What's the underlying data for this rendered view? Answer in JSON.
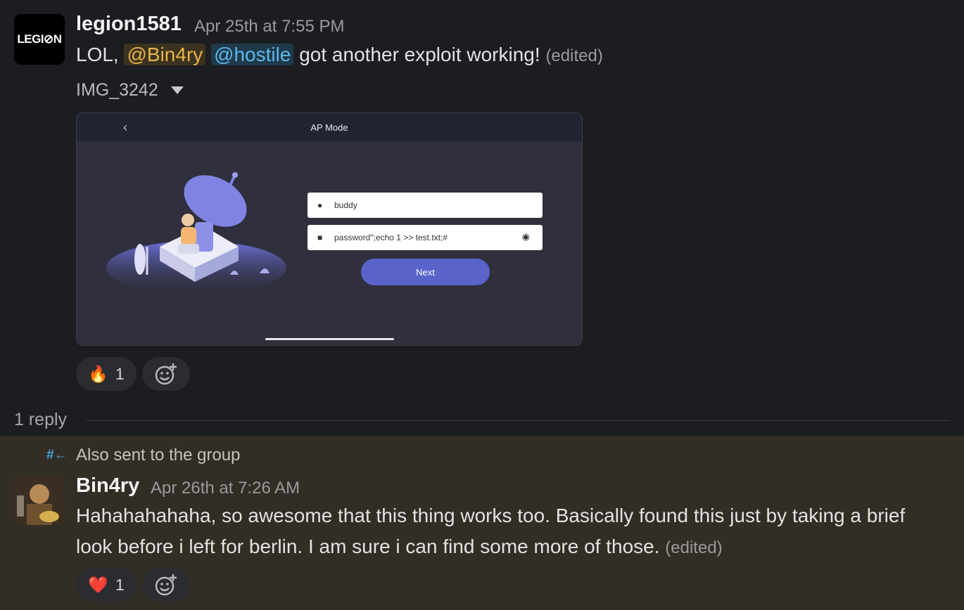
{
  "message1": {
    "avatar_text": "LEGI⊘N",
    "username": "legion1581",
    "timestamp": "Apr 25th at 7:55 PM",
    "text_prefix": "LOL,",
    "mention1": "@Bin4ry",
    "mention2": "@hostile",
    "text_suffix": "got another exploit working!",
    "edited": "(edited)",
    "attachment_name": "IMG_3242",
    "screenshot": {
      "header_title": "AP Mode",
      "username_value": "buddy",
      "password_value": "password\";echo 1 >> test.txt;#",
      "button_label": "Next"
    },
    "reaction": {
      "emoji": "🔥",
      "count": "1"
    }
  },
  "thread": {
    "reply_count": "1 reply"
  },
  "message2": {
    "group_note": "Also sent to the group",
    "username": "Bin4ry",
    "timestamp": "Apr 26th at 7:26 AM",
    "line1": "Hahahahahaha, so awesome that this thing works too. Basically found this just by taking a brief",
    "line2": "look before i left for berlin. I am sure i can find some more of those.",
    "edited": "(edited)",
    "reaction": {
      "emoji": "❤️",
      "count": "1"
    }
  },
  "colors": {
    "background": "#1b1d21",
    "highlight_background": "#322d25",
    "mention_yellow": "#e8b447",
    "mention_blue": "#5eb7ea",
    "next_button": "#5a63c9"
  },
  "icons": [
    "add-reaction-icon",
    "caret-down-icon",
    "channel-share-icon",
    "user-icon",
    "lock-icon",
    "eye-icon",
    "back-chevron-icon"
  ]
}
